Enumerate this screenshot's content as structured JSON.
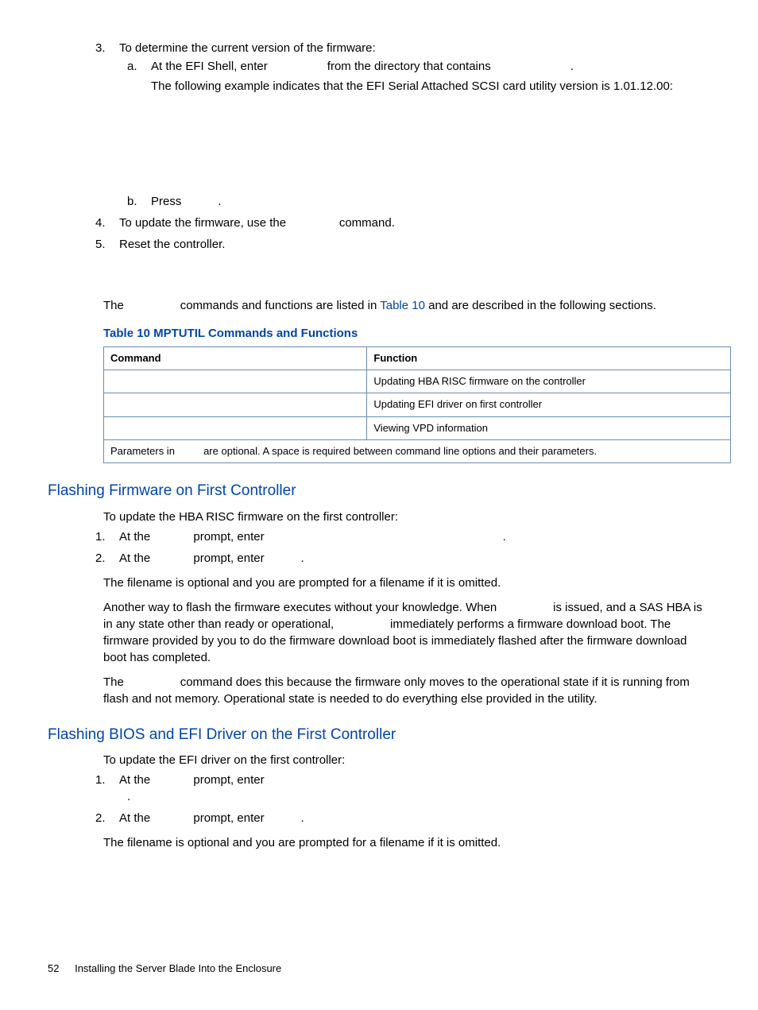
{
  "list": {
    "item3": {
      "num": "3.",
      "text": "To determine the current version of the firmware:",
      "a_let": "a.",
      "a_pre": "At the EFI Shell, enter ",
      "a_mid": " from the directory that contains ",
      "a_end": ".",
      "a_following": "The following example indicates that the EFI Serial Attached SCSI card utility version is 1.01.12.00:",
      "b_let": "b.",
      "b_pre": "Press ",
      "b_end": "."
    },
    "item4": {
      "num": "4.",
      "pre": "To update the firmware, use the ",
      "post": " command."
    },
    "item5": {
      "num": "5.",
      "text": "Reset the controller."
    }
  },
  "intro": {
    "pre": "The ",
    "mid": " commands and functions are listed in ",
    "link": "Table 10",
    "post": " and are described in the following sections."
  },
  "table": {
    "caption": "Table 10 MPTUTIL Commands and Functions",
    "h1": "Command",
    "h2": "Function",
    "r1c2": "Updating HBA RISC firmware on the controller",
    "r2c2": "Updating EFI driver on first controller",
    "r3c2": "Viewing VPD information",
    "note_pre": "Parameters in ",
    "note_post": " are optional. A space is required between command line options and their parameters."
  },
  "sec1": {
    "title": "Flashing Firmware on First Controller",
    "intro": "To update the HBA RISC firmware on the first controller:",
    "i1_num": "1.",
    "i1_pre": "At the ",
    "i1_mid": " prompt, enter ",
    "i1_end": ".",
    "i2_num": "2.",
    "i2_pre": "At the ",
    "i2_mid": " prompt, enter ",
    "i2_end": ".",
    "p1": "The filename is optional and you are prompted for a filename if it is omitted.",
    "p2_a": "Another way to flash the firmware executes without your knowledge. When ",
    "p2_b": " is issued, and a SAS HBA is in any state other than ready or operational, ",
    "p2_c": " immediately performs a firmware download boot. The firmware provided by you to do the firmware download boot is immediately flashed after the firmware download boot has completed.",
    "p3_a": "The ",
    "p3_b": " command does this because the firmware only moves to the operational state if it is running from flash and not memory. Operational state is needed to do everything else provided in the utility."
  },
  "sec2": {
    "title": "Flashing BIOS and EFI Driver on the First Controller",
    "intro": "To update the EFI driver on the first controller:",
    "i1_num": "1.",
    "i1_pre": "At the ",
    "i1_mid": " prompt, enter ",
    "i1_dot": ".",
    "i2_num": "2.",
    "i2_pre": "At the ",
    "i2_mid": " prompt, enter ",
    "i2_end": ".",
    "p1": "The filename is optional and you are prompted for a filename if it is omitted."
  },
  "footer": {
    "page": "52",
    "title": "Installing the Server Blade Into the Enclosure"
  }
}
